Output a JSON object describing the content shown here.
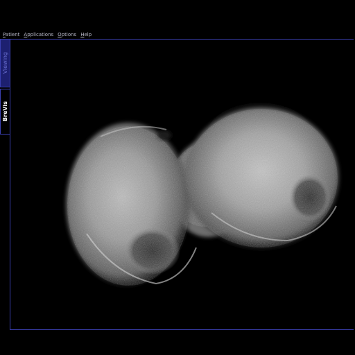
{
  "menu": {
    "items": [
      {
        "label": "Patient",
        "mnemonic": "P",
        "rest": "atient"
      },
      {
        "label": "Applications",
        "mnemonic": "A",
        "rest": "pplications"
      },
      {
        "label": "Options",
        "mnemonic": "O",
        "rest": "ptions"
      },
      {
        "label": "Help",
        "mnemonic": "H",
        "rest": "elp"
      }
    ]
  },
  "tabs": {
    "viewing": "Viewing",
    "brevis": "BreVis"
  },
  "colors": {
    "frame": "#3a3fb0",
    "active_tab_bg": "#1d2070",
    "background": "#000000"
  },
  "render": {
    "content": "3D ultrasound volume rendering, grayscale"
  }
}
